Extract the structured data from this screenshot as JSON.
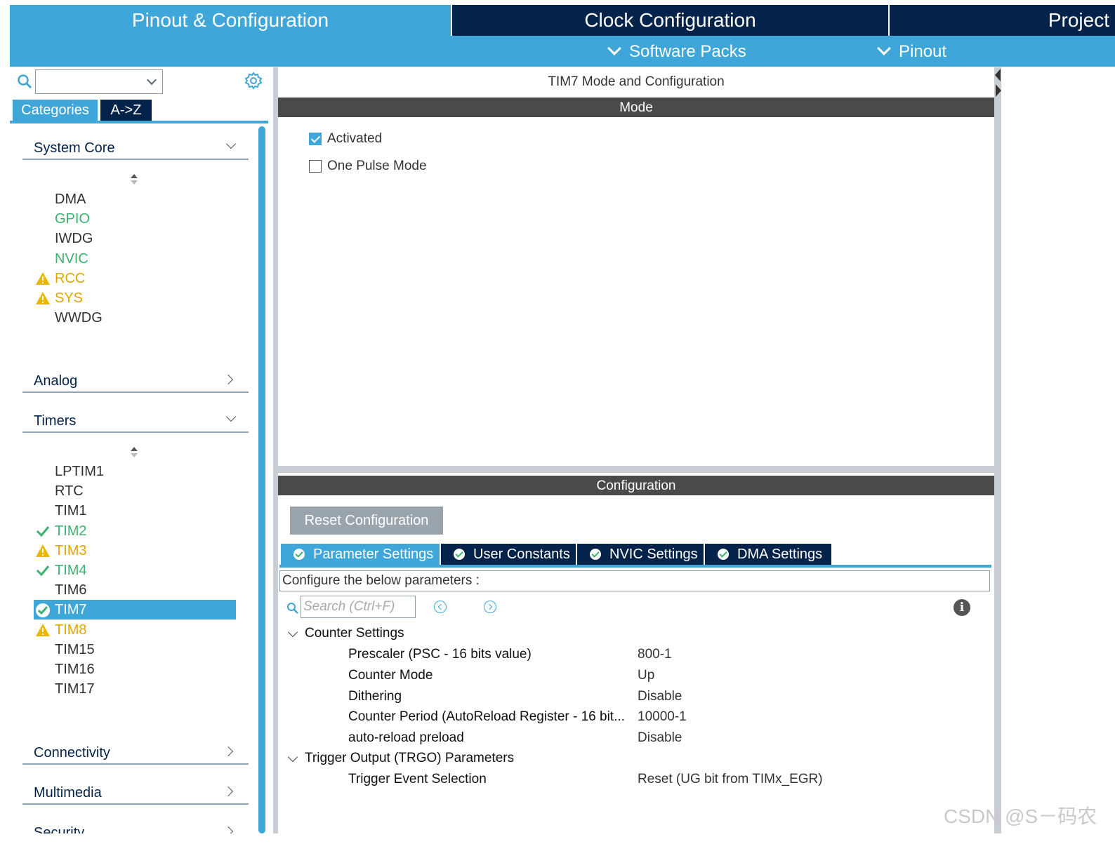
{
  "top_tabs": {
    "pinout": "Pinout & Configuration",
    "clock": "Clock Configuration",
    "project": "Project"
  },
  "sub_bar": {
    "software_packs": "Software Packs",
    "pinout": "Pinout"
  },
  "left": {
    "search_value": "",
    "tabs": {
      "categories": "Categories",
      "az": "A->Z"
    },
    "sections": {
      "system_core": "System Core",
      "analog": "Analog",
      "timers": "Timers",
      "connectivity": "Connectivity",
      "multimedia": "Multimedia",
      "security": "Security"
    },
    "system_core_items": [
      {
        "label": "DMA",
        "status": "none"
      },
      {
        "label": "GPIO",
        "status": "configured"
      },
      {
        "label": "IWDG",
        "status": "none"
      },
      {
        "label": "NVIC",
        "status": "configured"
      },
      {
        "label": "RCC",
        "status": "warning"
      },
      {
        "label": "SYS",
        "status": "warning"
      },
      {
        "label": "WWDG",
        "status": "none"
      }
    ],
    "timer_items": [
      {
        "label": "LPTIM1",
        "status": "none"
      },
      {
        "label": "RTC",
        "status": "none"
      },
      {
        "label": "TIM1",
        "status": "none"
      },
      {
        "label": "TIM2",
        "status": "ok"
      },
      {
        "label": "TIM3",
        "status": "warning"
      },
      {
        "label": "TIM4",
        "status": "ok"
      },
      {
        "label": "TIM6",
        "status": "none"
      },
      {
        "label": "TIM7",
        "status": "selected-ok"
      },
      {
        "label": "TIM8",
        "status": "warning"
      },
      {
        "label": "TIM15",
        "status": "none"
      },
      {
        "label": "TIM16",
        "status": "none"
      },
      {
        "label": "TIM17",
        "status": "none"
      }
    ]
  },
  "center": {
    "title": "TIM7 Mode and Configuration",
    "mode_bar": "Mode",
    "activated": {
      "label": "Activated",
      "checked": true
    },
    "one_pulse": {
      "label": "One Pulse Mode",
      "checked": false
    },
    "config_bar": "Configuration",
    "reset_button": "Reset Configuration",
    "tabs": {
      "parameter": "Parameter Settings",
      "user": "User Constants",
      "nvic": "NVIC Settings",
      "dma": "DMA Settings"
    },
    "configure_text": "Configure the below parameters :",
    "search_placeholder": "Search (Ctrl+F)",
    "groups": {
      "counter": "Counter Settings",
      "trigger": "Trigger Output (TRGO) Parameters"
    },
    "counter_params": [
      {
        "name": "Prescaler (PSC - 16 bits value)",
        "value": "800-1"
      },
      {
        "name": "Counter Mode",
        "value": "Up"
      },
      {
        "name": "Dithering",
        "value": "Disable"
      },
      {
        "name": "Counter Period (AutoReload Register - 16 bit...",
        "value": "10000-1"
      },
      {
        "name": "auto-reload preload",
        "value": "Disable"
      }
    ],
    "trigger_params": [
      {
        "name": "Trigger Event Selection",
        "value": "Reset (UG bit from TIMx_EGR)"
      }
    ]
  },
  "watermark": "CSDN @S－码农",
  "colors": {
    "accent": "#3ea6d9",
    "navy": "#03234b",
    "ok_green": "#3cb371",
    "warning": "#e8b800",
    "bar_gray": "#4a4a4a"
  }
}
